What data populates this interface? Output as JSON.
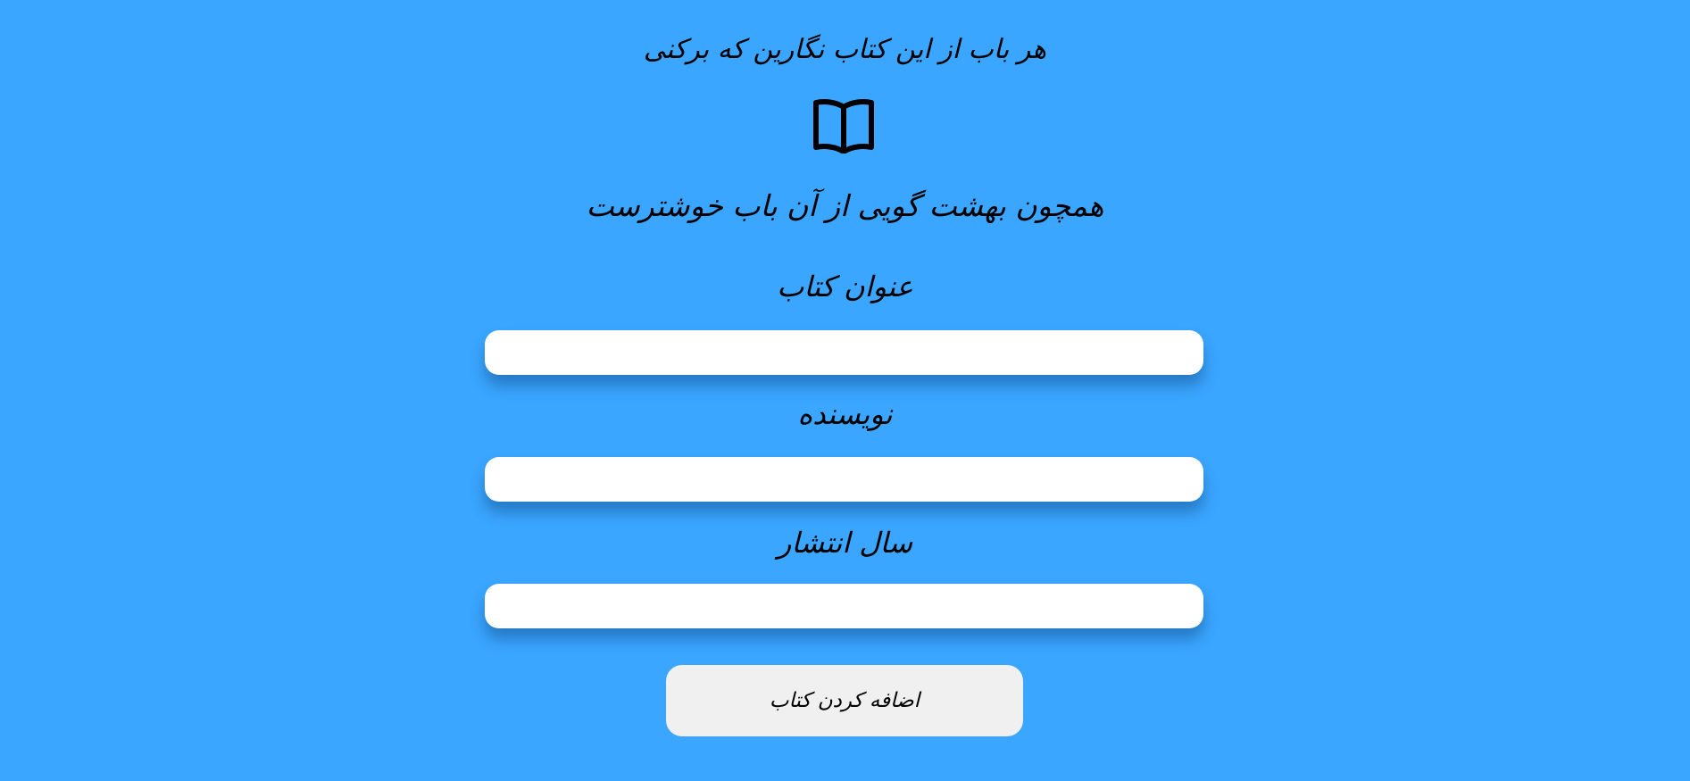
{
  "header": {
    "poem_line_1": "هر باب از این کتاب نگارین که برکنی",
    "book_icon": "open-book-icon",
    "poem_line_2": "همچون بهشت گویی از آن باب خوشترست"
  },
  "form": {
    "title_label": "عنوان کتاب",
    "title_value": "",
    "author_label": "نویسنده",
    "author_value": "",
    "year_label": "سال انتشار",
    "year_value": "",
    "submit_label": "اضافه کردن کتاب"
  },
  "colors": {
    "background": "#3aa6ff",
    "field_background": "#ffffff",
    "button_background": "#f0f0f0",
    "text": "#000000"
  }
}
